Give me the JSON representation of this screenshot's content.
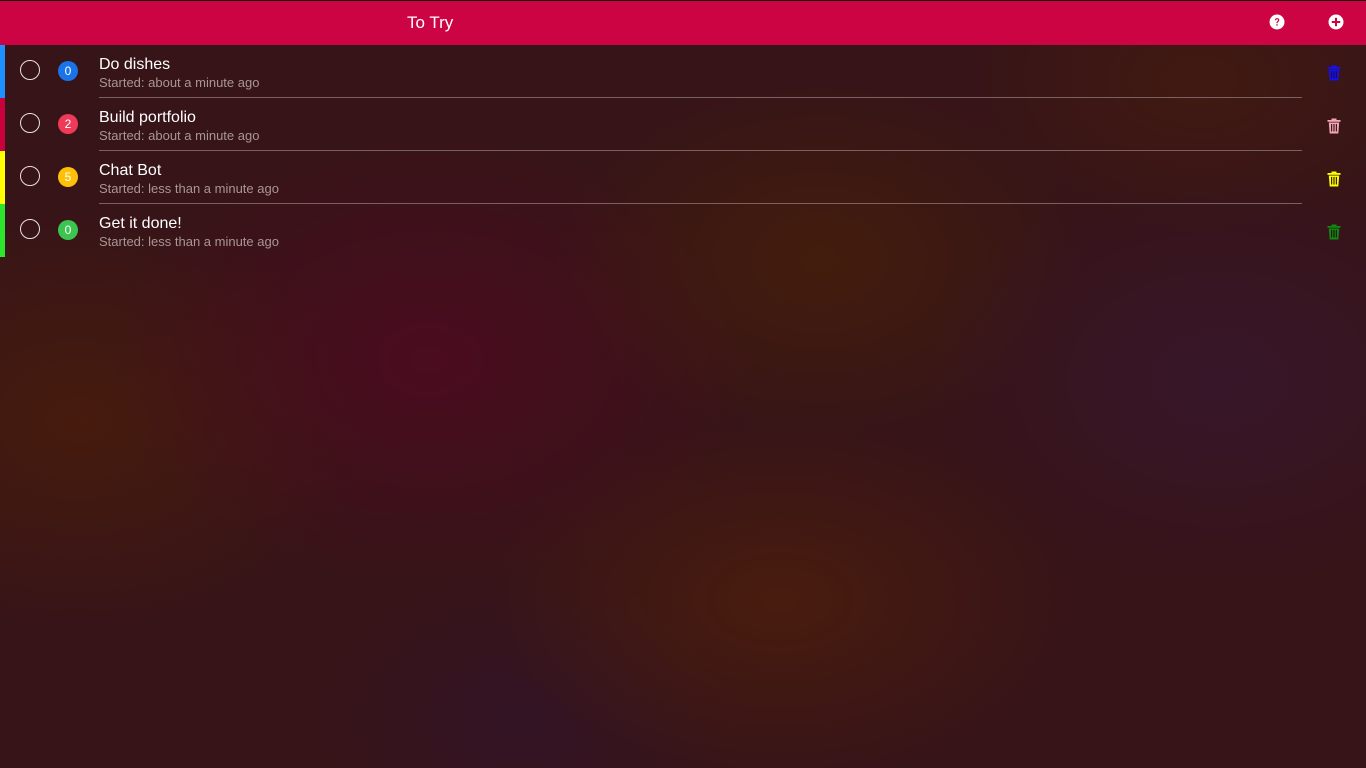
{
  "header": {
    "title": "To Try",
    "help_icon": "question-circle-icon",
    "add_icon": "plus-circle-icon"
  },
  "colors": {
    "header_bg": "#cc0444",
    "checkbox_border": "#e8e0e0",
    "subtitle_text": "#a89696"
  },
  "tasks": [
    {
      "name": "Do dishes",
      "count": "0",
      "started": "Started: about a minute ago",
      "stripe_color": "#1e90ff",
      "badge_color": "#1a73e8",
      "trash_color": "#1010ff"
    },
    {
      "name": "Build portfolio",
      "count": "2",
      "started": "Started: about a minute ago",
      "stripe_color": "#c8003c",
      "badge_color": "#f03a5a",
      "trash_color": "#f4a6b4"
    },
    {
      "name": "Chat Bot",
      "count": "5",
      "started": "Started: less than a minute ago",
      "stripe_color": "#ffff00",
      "badge_color": "#ffc107",
      "trash_color": "#ffff00"
    },
    {
      "name": "Get it done!",
      "count": "0",
      "started": "Started: less than a minute ago",
      "stripe_color": "#2ee52e",
      "badge_color": "#3cc451",
      "trash_color": "#0f8a0f"
    }
  ]
}
